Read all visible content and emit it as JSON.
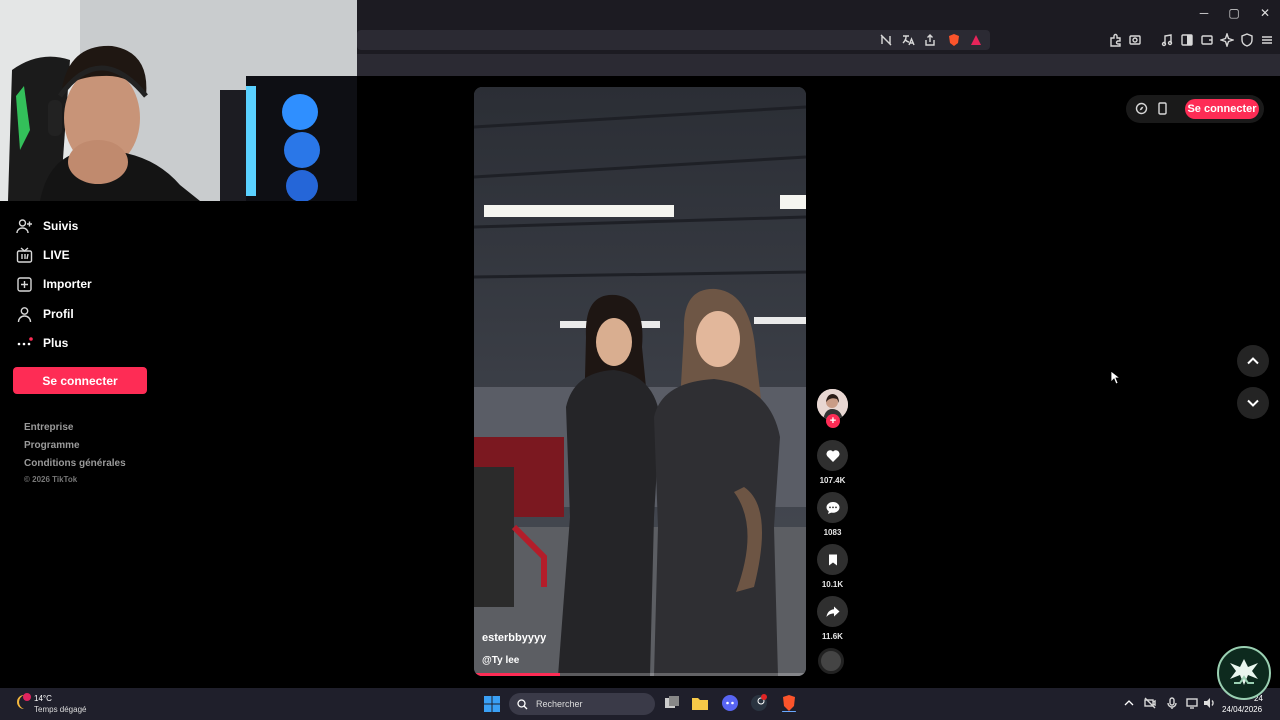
{
  "browser": {
    "window_controls": [
      "─",
      "▢",
      "✕"
    ]
  },
  "sidebar": {
    "items": [
      {
        "label": "Suivis",
        "icon": "following-icon"
      },
      {
        "label": "LIVE",
        "icon": "live-icon"
      },
      {
        "label": "Importer",
        "icon": "upload-icon"
      },
      {
        "label": "Profil",
        "icon": "profile-icon"
      },
      {
        "label": "Plus",
        "icon": "more-icon"
      }
    ],
    "login_label": "Se connecter",
    "footer_links": [
      "Entreprise",
      "Programme",
      "Conditions générales"
    ],
    "copyright": "© 2026 TikTok"
  },
  "video": {
    "author": "esterbbyyyy",
    "sound": "@Ty lee",
    "progress_pct": 26
  },
  "actions": {
    "likes": "107.4K",
    "comments": "1083",
    "saves": "10.1K",
    "shares": "11.6K"
  },
  "header_right": {
    "login_label": "Se connecter"
  },
  "taskbar": {
    "temperature": "14°C",
    "weather": "Temps dégagé",
    "search_placeholder": "Rechercher",
    "date": "24/04/2026",
    "time": "24"
  },
  "colors": {
    "accent": "#fe2c55",
    "background": "#000000",
    "taskbar": "#1f1f2b"
  }
}
